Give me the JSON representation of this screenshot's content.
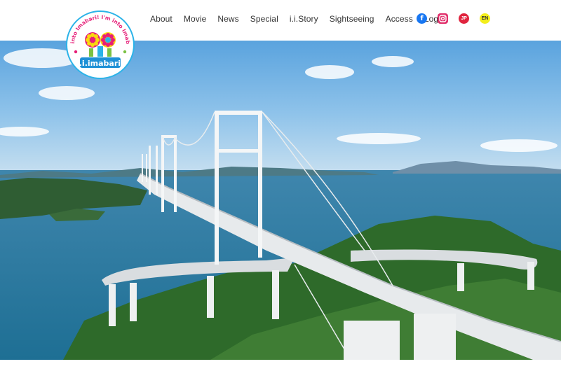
{
  "logo": {
    "top_text": "I'm into Imabari! I'm into Imabari!",
    "brand": "i.i.imabari!"
  },
  "nav": {
    "items": [
      "About",
      "Movie",
      "News",
      "Special",
      "i.i.Story",
      "Sightseeing",
      "Access",
      "Logo"
    ]
  },
  "social": {
    "facebook_glyph": "f",
    "instagram": "instagram-icon",
    "jp_label": "JP",
    "en_label": "EN"
  },
  "colors": {
    "facebook": "#1877f2",
    "instagram": "#e1306c",
    "jp": "#e0243e",
    "en": "#f3ee1c"
  }
}
